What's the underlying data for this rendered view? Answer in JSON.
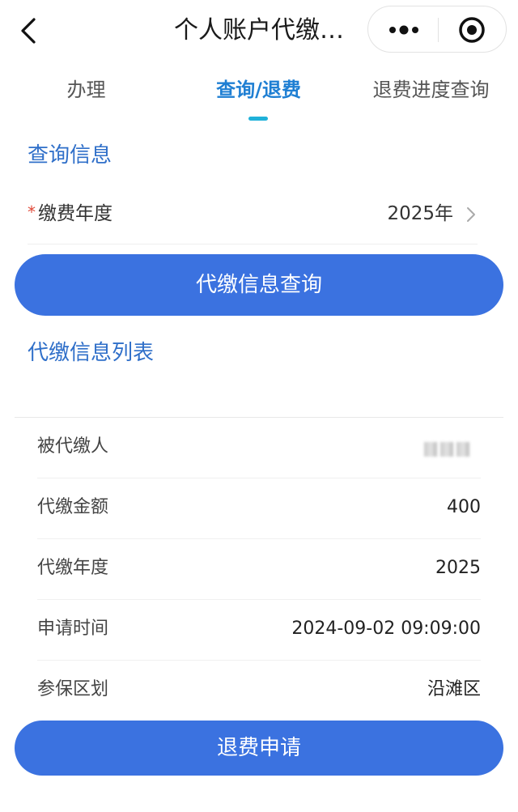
{
  "header": {
    "title": "个人账户代缴…",
    "back_icon": "chevron-left-icon",
    "more_icon": "more-dots-icon",
    "close_icon": "target-circle-icon"
  },
  "tabs": [
    {
      "label": "办理",
      "active": false
    },
    {
      "label": "查询/退费",
      "active": true
    },
    {
      "label": "退费进度查询",
      "active": false
    }
  ],
  "query_section": {
    "title": "查询信息",
    "year_field": {
      "required_mark": "*",
      "label": "缴费年度",
      "value": "2025年"
    },
    "query_button": "代缴信息查询"
  },
  "list_section": {
    "title": "代缴信息列表",
    "rows": [
      {
        "key": "被代缴人",
        "value": ""
      },
      {
        "key": "代缴金额",
        "value": "400"
      },
      {
        "key": "代缴年度",
        "value": "2025"
      },
      {
        "key": "申请时间",
        "value": "2024-09-02 09:09:00"
      },
      {
        "key": "参保区划",
        "value": "沿滩区"
      }
    ],
    "refund_button": "退费申请"
  },
  "colors": {
    "accent": "#3b72e0",
    "active_tab": "#1f7fd3",
    "section_title": "#2f6fc9",
    "required": "#e04a3a"
  }
}
